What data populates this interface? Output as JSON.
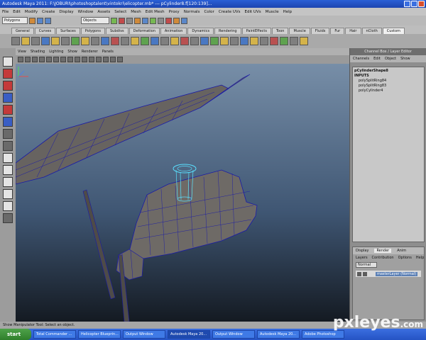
{
  "window": {
    "title": "Autodesk Maya 2011: F:\\JOBURI\\photoshoptalent\\vintokri\\elicopter.mb*  ---  pCylinder8.f[120:139]..."
  },
  "menubar": [
    "File",
    "Edit",
    "Modify",
    "Create",
    "Display",
    "Window",
    "Assets",
    "Select",
    "Mesh",
    "Edit Mesh",
    "Proxy",
    "Normals",
    "Color",
    "Create UVs",
    "Edit UVs",
    "Muscle",
    "Help"
  ],
  "toolrow": {
    "mode": "Polygons",
    "objects": "Objects"
  },
  "shelf_tabs": [
    "General",
    "Curves",
    "Surfaces",
    "Polygons",
    "Subdivs",
    "Deformation",
    "Animation",
    "Dynamics",
    "Rendering",
    "PaintEffects",
    "Toon",
    "Muscle",
    "Fluids",
    "Fur",
    "Hair",
    "nCloth",
    "Custom"
  ],
  "shelf_active": "Custom",
  "viewport": {
    "menu": [
      "View",
      "Shading",
      "Lighting",
      "Show",
      "Renderer",
      "Panels"
    ]
  },
  "channel_box": {
    "title": "Channel Box / Layer Editor",
    "tabs": [
      "Channels",
      "Edit",
      "Object",
      "Show"
    ],
    "node": "pCylinderShape8",
    "inputs_label": "INPUTS",
    "inputs": [
      "polySplitRing84",
      "polySplitRing83",
      "polyCylinder4"
    ]
  },
  "layer_editor": {
    "tabs": [
      "Display",
      "Render",
      "Anim"
    ],
    "active_tab": "Render",
    "menu": [
      "Layers",
      "Contribution",
      "Options",
      "Help"
    ],
    "mode": "Normal",
    "layer_name": "masterLayer (Normal)"
  },
  "help_line": "Show Manipulator Tool: Select an object.",
  "taskbar": {
    "start": "start",
    "tasks": [
      "Total Commander ...",
      "Helicopter Blueprin...",
      "Output Window",
      "Autodesk Maya 20...",
      "Output Window",
      "Autodesk Maya 20...",
      "Adobe Photoshop"
    ]
  },
  "watermark": "pxleyes",
  "watermark_tld": ".com",
  "colors": {
    "wire": "#1a1aa8",
    "hull": "#6e6a66",
    "selected": "#59e0ff"
  }
}
